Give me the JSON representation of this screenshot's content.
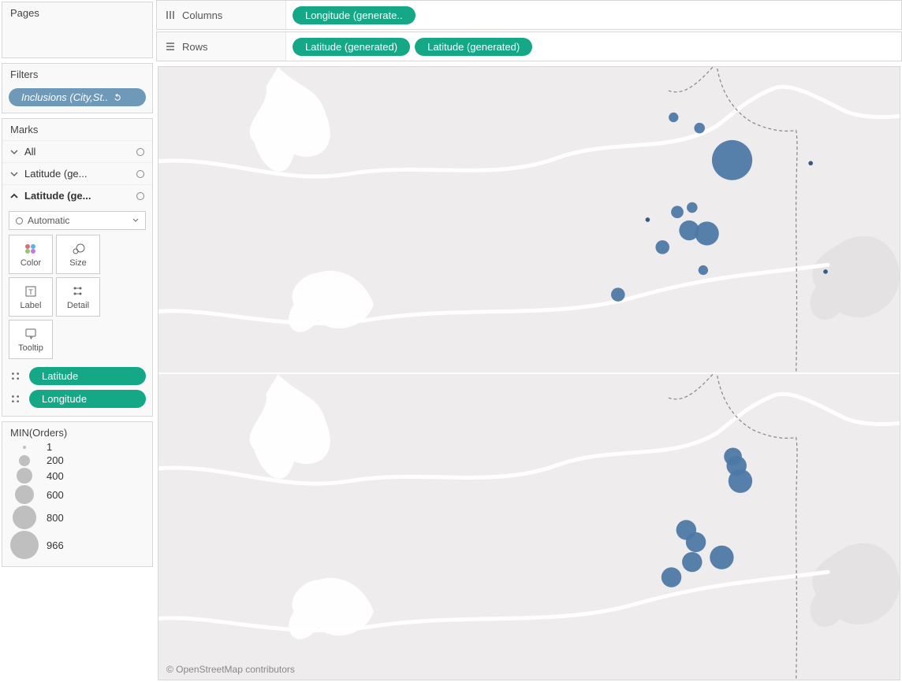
{
  "shelves": {
    "columns_label": "Columns",
    "rows_label": "Rows",
    "columns_pills": [
      "Longitude (generate.."
    ],
    "rows_pills": [
      "Latitude (generated)",
      "Latitude (generated)"
    ]
  },
  "cards": {
    "pages": {
      "title": "Pages"
    },
    "filters": {
      "title": "Filters",
      "pill": "Inclusions (City,St.."
    },
    "marks": {
      "title": "Marks",
      "all": "All",
      "lat1": "Latitude (ge...",
      "lat2": "Latitude (ge...",
      "mark_type": "Automatic",
      "buttons": {
        "color": "Color",
        "size": "Size",
        "label": "Label",
        "detail": "Detail",
        "tooltip": "Tooltip"
      },
      "detail_pills": [
        "Latitude",
        "Longitude"
      ]
    },
    "legend": {
      "title": "MIN(Orders)",
      "items": [
        {
          "label": "1",
          "r": 2
        },
        {
          "label": "200",
          "r": 7
        },
        {
          "label": "400",
          "r": 10
        },
        {
          "label": "600",
          "r": 12
        },
        {
          "label": "800",
          "r": 15
        },
        {
          "label": "966",
          "r": 18
        }
      ]
    }
  },
  "viz": {
    "attribution": "© OpenStreetMap contributors"
  },
  "chart_data": [
    {
      "type": "scatter",
      "title": "",
      "xlabel": "",
      "ylabel": "",
      "series": [
        {
          "name": "MIN(Orders)",
          "points": [
            {
              "x": 0.774,
              "y": 0.305,
              "size": 966
            },
            {
              "x": 0.74,
              "y": 0.545,
              "size": 300
            },
            {
              "x": 0.716,
              "y": 0.535,
              "size": 200
            },
            {
              "x": 0.7,
              "y": 0.475,
              "size": 60
            },
            {
              "x": 0.72,
              "y": 0.46,
              "size": 40
            },
            {
              "x": 0.68,
              "y": 0.59,
              "size": 80
            },
            {
              "x": 0.62,
              "y": 0.745,
              "size": 80
            },
            {
              "x": 0.695,
              "y": 0.165,
              "size": 30
            },
            {
              "x": 0.73,
              "y": 0.2,
              "size": 40
            },
            {
              "x": 0.735,
              "y": 0.665,
              "size": 30
            },
            {
              "x": 0.88,
              "y": 0.315,
              "size": 1
            },
            {
              "x": 0.9,
              "y": 0.67,
              "size": 1
            },
            {
              "x": 0.66,
              "y": 0.5,
              "size": 1
            }
          ]
        }
      ]
    },
    {
      "type": "scatter",
      "title": "",
      "xlabel": "",
      "ylabel": "",
      "series": [
        {
          "name": "MIN(Orders)",
          "points": [
            {
              "x": 0.78,
              "y": 0.3,
              "size": 200
            },
            {
              "x": 0.785,
              "y": 0.35,
              "size": 300
            },
            {
              "x": 0.76,
              "y": 0.6,
              "size": 300
            },
            {
              "x": 0.72,
              "y": 0.615,
              "size": 200
            },
            {
              "x": 0.712,
              "y": 0.51,
              "size": 200
            },
            {
              "x": 0.725,
              "y": 0.55,
              "size": 200
            },
            {
              "x": 0.692,
              "y": 0.665,
              "size": 200
            },
            {
              "x": 0.775,
              "y": 0.27,
              "size": 150
            }
          ]
        }
      ]
    }
  ]
}
